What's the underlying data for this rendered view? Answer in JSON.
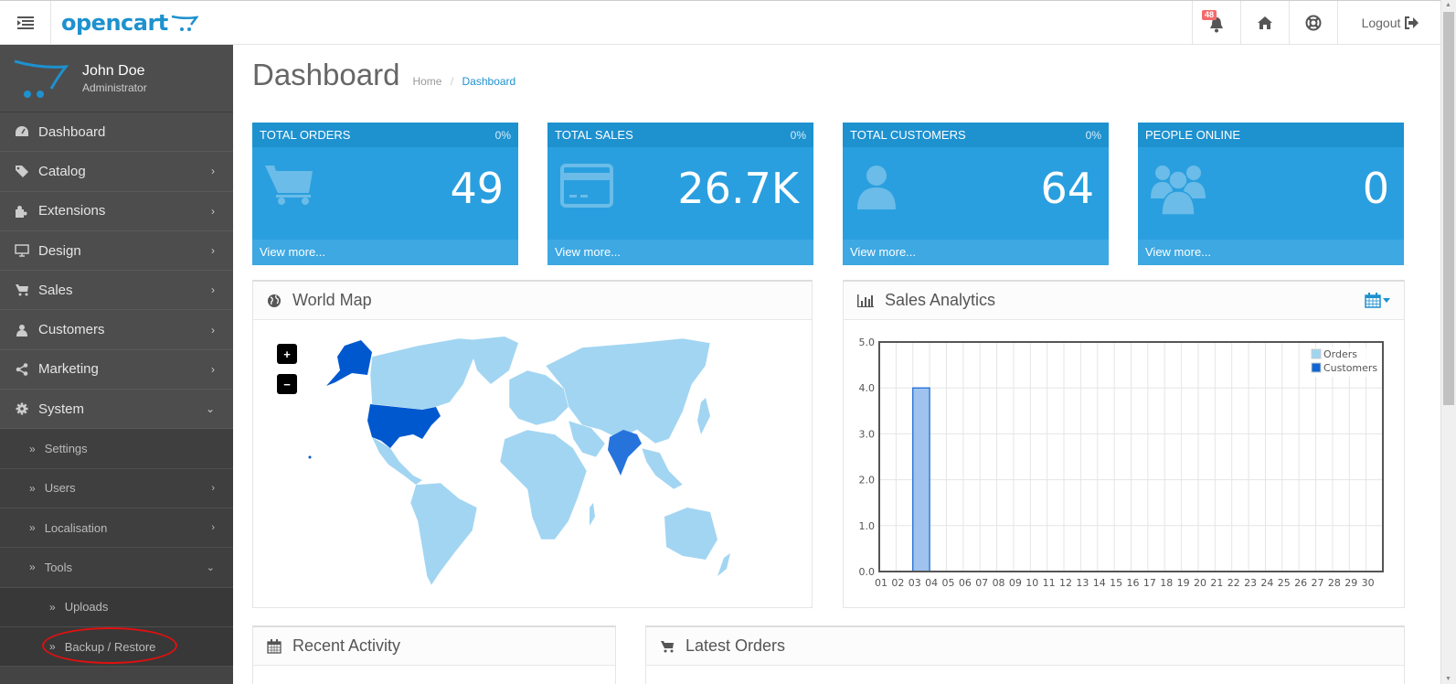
{
  "header": {
    "logo_text": "opencart",
    "notifications_count": "48",
    "logout_label": "Logout",
    "icons": {
      "menu": "menu-toggle-icon",
      "bell": "bell-icon",
      "home": "home-icon",
      "help": "life-ring-icon",
      "logout": "sign-out-icon"
    }
  },
  "profile": {
    "name": "John Doe",
    "role": "Administrator"
  },
  "sidebar": {
    "items": [
      {
        "label": "Dashboard",
        "icon": "dashboard-icon",
        "has_children": false
      },
      {
        "label": "Catalog",
        "icon": "tags-icon",
        "has_children": true
      },
      {
        "label": "Extensions",
        "icon": "puzzle-icon",
        "has_children": true
      },
      {
        "label": "Design",
        "icon": "desktop-icon",
        "has_children": true
      },
      {
        "label": "Sales",
        "icon": "cart-icon",
        "has_children": true
      },
      {
        "label": "Customers",
        "icon": "user-icon",
        "has_children": true
      },
      {
        "label": "Marketing",
        "icon": "share-icon",
        "has_children": true
      },
      {
        "label": "System",
        "icon": "gear-icon",
        "has_children": true,
        "expanded": true
      }
    ],
    "system_children": [
      {
        "label": "Settings",
        "has_children": false
      },
      {
        "label": "Users",
        "has_children": true
      },
      {
        "label": "Localisation",
        "has_children": true
      },
      {
        "label": "Tools",
        "has_children": true,
        "expanded": true
      }
    ],
    "tools_children": [
      {
        "label": "Uploads"
      },
      {
        "label": "Backup / Restore",
        "highlighted": true
      }
    ]
  },
  "page": {
    "title": "Dashboard",
    "breadcrumb": [
      {
        "label": "Home"
      },
      {
        "label": "Dashboard",
        "active": true
      }
    ]
  },
  "tiles": [
    {
      "title": "TOTAL ORDERS",
      "percent": "0%",
      "value": "49",
      "footer": "View more...",
      "icon": "cart-icon"
    },
    {
      "title": "TOTAL SALES",
      "percent": "0%",
      "value": "26.7K",
      "footer": "View more...",
      "icon": "credit-card-icon"
    },
    {
      "title": "TOTAL CUSTOMERS",
      "percent": "0%",
      "value": "64",
      "footer": "View more...",
      "icon": "user-icon"
    },
    {
      "title": "PEOPLE ONLINE",
      "percent": "",
      "value": "0",
      "footer": "View more...",
      "icon": "users-icon"
    }
  ],
  "panels": {
    "world_map": {
      "title": "World Map",
      "zoom_in": "+",
      "zoom_out": "−",
      "highlighted_countries": [
        "United States",
        "India"
      ]
    },
    "sales_analytics": {
      "title": "Sales Analytics"
    },
    "recent_activity": {
      "title": "Recent Activity"
    },
    "latest_orders": {
      "title": "Latest Orders"
    }
  },
  "colors": {
    "brand": "#1e91cf",
    "tile_bg": "#2a9fdf",
    "sidebar_bg": "#4d4d4d",
    "orders_series": "#9fd5f1",
    "customers_series": "#1065d2"
  },
  "chart_data": {
    "type": "bar",
    "title": "Sales Analytics",
    "xlabel": "",
    "ylabel": "",
    "categories": [
      "01",
      "02",
      "03",
      "04",
      "05",
      "06",
      "07",
      "08",
      "09",
      "10",
      "11",
      "12",
      "13",
      "14",
      "15",
      "16",
      "17",
      "18",
      "19",
      "20",
      "21",
      "22",
      "23",
      "24",
      "25",
      "26",
      "27",
      "28",
      "29",
      "30"
    ],
    "series": [
      {
        "name": "Orders",
        "values": [
          0,
          0,
          4,
          0,
          0,
          0,
          0,
          0,
          0,
          0,
          0,
          0,
          0,
          0,
          0,
          0,
          0,
          0,
          0,
          0,
          0,
          0,
          0,
          0,
          0,
          0,
          0,
          0,
          0,
          0
        ]
      },
      {
        "name": "Customers",
        "values": [
          0,
          0,
          0,
          0,
          0,
          0,
          0,
          0,
          0,
          0,
          0,
          0,
          0,
          0,
          0,
          0,
          0,
          0,
          0,
          0,
          0,
          0,
          0,
          0,
          0,
          0,
          0,
          0,
          0,
          0
        ]
      }
    ],
    "yticks": [
      "0.0",
      "1.0",
      "2.0",
      "3.0",
      "4.0",
      "5.0"
    ],
    "ylim": [
      0,
      5
    ],
    "grid": true,
    "legend": "top-right"
  }
}
